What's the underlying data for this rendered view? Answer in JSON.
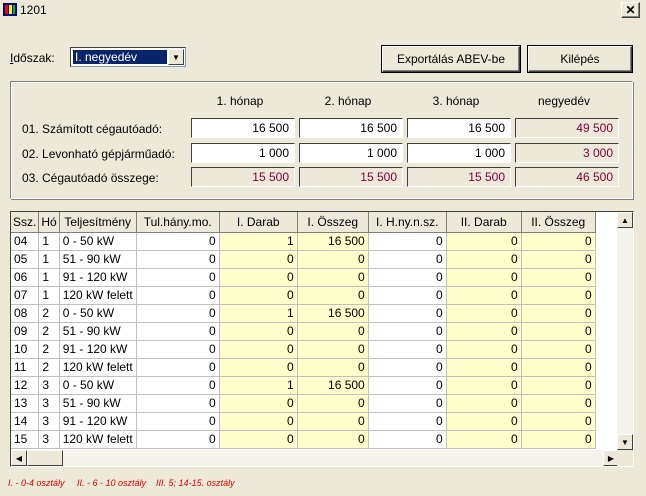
{
  "window": {
    "title": "1201",
    "close_label": "✕"
  },
  "toolbar": {
    "period_label_underlined": "I",
    "period_label_rest": "dőszak:",
    "period_value": "I. negyedév",
    "export_label": "Exportálás ABEV-be",
    "exit_label": "Kilépés"
  },
  "summary": {
    "columns": [
      "1. hónap",
      "2. hónap",
      "3. hónap",
      "negyedév"
    ],
    "rows": [
      {
        "label": "01. Számított cégautóadó:",
        "values": [
          "16 500",
          "16 500",
          "16 500",
          "49 500"
        ]
      },
      {
        "label": "02. Levonható gépjárműadó:",
        "values": [
          "1 000",
          "1 000",
          "1 000",
          "3 000"
        ]
      },
      {
        "label": "03. Cégautóadó összege:",
        "values": [
          "15 500",
          "15 500",
          "15 500",
          "46 500"
        ]
      }
    ]
  },
  "grid": {
    "headers": [
      "Ssz.",
      "Hó",
      "Teljesítmény",
      "Tul.hány.mo.",
      "I. Darab",
      "I. Összeg",
      "I. H.ny.n.sz.",
      "II. Darab",
      "II. Összeg"
    ],
    "rows": [
      [
        "04",
        "1",
        "0 - 50 kW",
        "0",
        "1",
        "16 500",
        "0",
        "0",
        "0"
      ],
      [
        "05",
        "1",
        "51 - 90 kW",
        "0",
        "0",
        "0",
        "0",
        "0",
        "0"
      ],
      [
        "06",
        "1",
        "91 - 120 kW",
        "0",
        "0",
        "0",
        "0",
        "0",
        "0"
      ],
      [
        "07",
        "1",
        "120 kW felett",
        "0",
        "0",
        "0",
        "0",
        "0",
        "0"
      ],
      [
        "08",
        "2",
        "0 - 50 kW",
        "0",
        "1",
        "16 500",
        "0",
        "0",
        "0"
      ],
      [
        "09",
        "2",
        "51 - 90 kW",
        "0",
        "0",
        "0",
        "0",
        "0",
        "0"
      ],
      [
        "10",
        "2",
        "91 - 120 kW",
        "0",
        "0",
        "0",
        "0",
        "0",
        "0"
      ],
      [
        "11",
        "2",
        "120 kW felett",
        "0",
        "0",
        "0",
        "0",
        "0",
        "0"
      ],
      [
        "12",
        "3",
        "0 - 50 kW",
        "0",
        "1",
        "16 500",
        "0",
        "0",
        "0"
      ],
      [
        "13",
        "3",
        "51 - 90 kW",
        "0",
        "0",
        "0",
        "0",
        "0",
        "0"
      ],
      [
        "14",
        "3",
        "91 - 120 kW",
        "0",
        "0",
        "0",
        "0",
        "0",
        "0"
      ],
      [
        "15",
        "3",
        "120 kW felett",
        "0",
        "0",
        "0",
        "0",
        "0",
        "0"
      ]
    ],
    "yellow_columns": [
      4,
      5,
      7,
      8
    ]
  },
  "legend": {
    "text": "I. - 0-4 osztály     II. - 6 - 10 osztály    III. 5; 14-15. osztály"
  },
  "colors": {
    "selection": "#0a246a",
    "readonly_text": "#800040",
    "highlight_cell": "#ffffcc",
    "legend_text": "#e00000"
  }
}
